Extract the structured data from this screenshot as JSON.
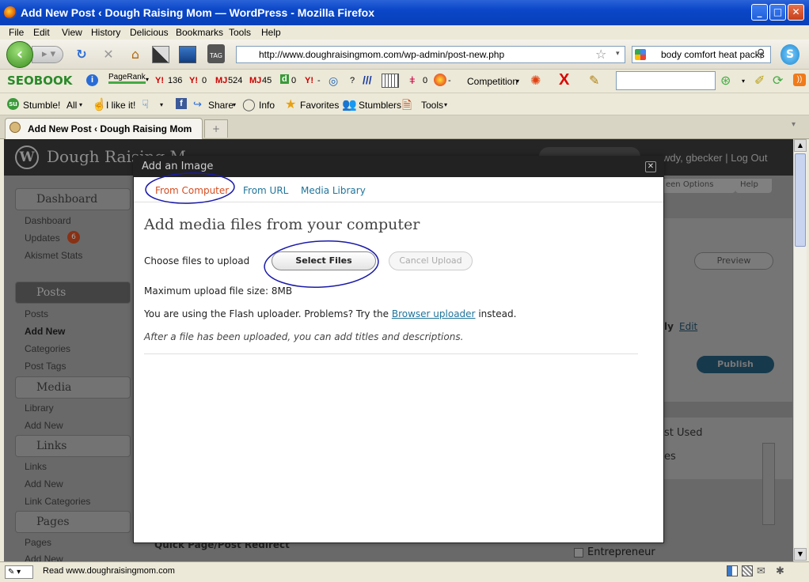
{
  "browser": {
    "window_title": "Add New Post ‹ Dough Raising Mom — WordPress - Mozilla Firefox",
    "menu": [
      "File",
      "Edit",
      "View",
      "History",
      "Delicious",
      "Bookmarks",
      "Tools",
      "Help"
    ],
    "url": "http://www.doughraisingmom.com/wp-admin/post-new.php",
    "search_text": "body comfort heat packs",
    "tab_title": "Add New Post ‹ Dough Raising Mom ...",
    "status_text": "Read www.doughraisingmom.com"
  },
  "seo_toolbar": {
    "brand": "SEOBOOK",
    "pagerank_label": "PageRank",
    "metrics": [
      {
        "label": "Y!",
        "value": "136"
      },
      {
        "label": "Y!",
        "value": "0"
      },
      {
        "label": "MJ",
        "value": "524"
      },
      {
        "label": "MJ",
        "value": "45"
      },
      {
        "label": "d",
        "value": "0"
      },
      {
        "label": "Y!",
        "value": "-"
      },
      {
        "label": "?",
        "value": ""
      },
      {
        "label": "",
        "value": "0"
      },
      {
        "label": "",
        "value": "-"
      }
    ],
    "competition_label": "Competition"
  },
  "stumble_toolbar": {
    "stumble": "Stumble!",
    "all": "All",
    "like": "I like it!",
    "share": "Share",
    "info": "Info",
    "favorites": "Favorites",
    "stumblers": "Stumblers",
    "tools": "Tools"
  },
  "wp": {
    "site_title": "Dough Raising M",
    "howdy": "wdy, gbecker | Log Out",
    "screen_options": "een Options",
    "help": "Help",
    "sidebar": [
      {
        "head": "Dashboard",
        "items": [
          "Dashboard",
          "Updates",
          "Akismet Stats"
        ],
        "badge": "6"
      },
      {
        "head": "Posts",
        "items": [
          "Posts",
          "Add New",
          "Categories",
          "Post Tags"
        ]
      },
      {
        "head": "Media",
        "items": [
          "Library",
          "Add New"
        ]
      },
      {
        "head": "Links",
        "items": [
          "Links",
          "Add New",
          "Link Categories"
        ]
      },
      {
        "head": "Pages",
        "items": [
          "Pages",
          "Add New"
        ]
      }
    ],
    "preview": "Preview",
    "publish": "Publish",
    "edit_partial": "ly",
    "edit_link": "Edit",
    "most_used": "st Used",
    "es_partial": "es",
    "entrepreneur": "Entrepreneur",
    "quick_redirect": "Quick Page/Post Redirect"
  },
  "dialog": {
    "title": "Add an Image",
    "tabs": [
      "From Computer",
      "From URL",
      "Media Library"
    ],
    "heading": "Add media files from your computer",
    "choose_label": "Choose files to upload",
    "select_button": "Select Files",
    "cancel_button": "Cancel Upload",
    "max_size": "Maximum upload file size: 8MB",
    "flash_text_before": "You are using the Flash uploader. Problems? Try the ",
    "browser_uploader_link": "Browser uploader",
    "flash_text_after": " instead.",
    "after_upload_note": "After a file has been uploaded, you can add titles and descriptions."
  },
  "colors": {
    "annotation": "#1a1aa8",
    "active_tab": "#d54e21",
    "link": "#21759b"
  }
}
